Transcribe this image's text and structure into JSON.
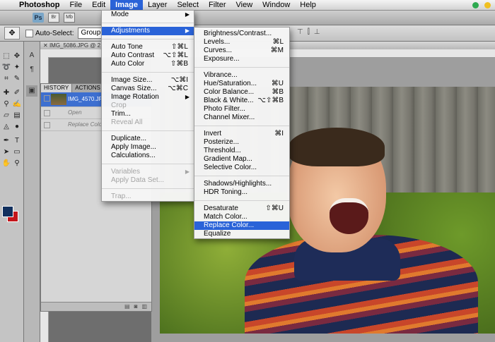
{
  "menubar": {
    "app_name": "Photoshop",
    "items": [
      "File",
      "Edit",
      "Image",
      "Layer",
      "Select",
      "Filter",
      "View",
      "Window",
      "Help"
    ],
    "active_item": "Image"
  },
  "appbar": {
    "logo": "Ps",
    "icons": [
      "Br",
      "Mb"
    ]
  },
  "options": {
    "auto_select_label": "Auto-Select:",
    "auto_select_value": "Group"
  },
  "document": {
    "tab_title": "IMG_5086.JPG @ 2"
  },
  "history_panel": {
    "tabs": [
      "HISTORY",
      "ACTIONS"
    ],
    "snapshot": "IMG_4570.JP",
    "steps": [
      "Open",
      "Replace Colo"
    ]
  },
  "image_menu": {
    "items": [
      {
        "label": "Mode",
        "shortcut": "",
        "submenu": true,
        "disabled": false
      },
      {
        "sep": true
      },
      {
        "label": "Adjustments",
        "shortcut": "",
        "submenu": true,
        "disabled": false,
        "highlighted": true
      },
      {
        "sep": true
      },
      {
        "label": "Auto Tone",
        "shortcut": "⇧⌘L"
      },
      {
        "label": "Auto Contrast",
        "shortcut": "⌥⇧⌘L"
      },
      {
        "label": "Auto Color",
        "shortcut": "⇧⌘B"
      },
      {
        "sep": true
      },
      {
        "label": "Image Size...",
        "shortcut": "⌥⌘I"
      },
      {
        "label": "Canvas Size...",
        "shortcut": "⌥⌘C"
      },
      {
        "label": "Image Rotation",
        "shortcut": "",
        "submenu": true
      },
      {
        "label": "Crop",
        "disabled": true
      },
      {
        "label": "Trim..."
      },
      {
        "label": "Reveal All",
        "disabled": true
      },
      {
        "sep": true
      },
      {
        "label": "Duplicate..."
      },
      {
        "label": "Apply Image..."
      },
      {
        "label": "Calculations..."
      },
      {
        "sep": true
      },
      {
        "label": "Variables",
        "submenu": true,
        "disabled": true
      },
      {
        "label": "Apply Data Set...",
        "disabled": true
      },
      {
        "sep": true
      },
      {
        "label": "Trap...",
        "disabled": true
      }
    ]
  },
  "adjustments_menu": {
    "items": [
      {
        "label": "Brightness/Contrast..."
      },
      {
        "label": "Levels...",
        "shortcut": "⌘L"
      },
      {
        "label": "Curves...",
        "shortcut": "⌘M"
      },
      {
        "label": "Exposure..."
      },
      {
        "sep": true
      },
      {
        "label": "Vibrance..."
      },
      {
        "label": "Hue/Saturation...",
        "shortcut": "⌘U"
      },
      {
        "label": "Color Balance...",
        "shortcut": "⌘B"
      },
      {
        "label": "Black & White...",
        "shortcut": "⌥⇧⌘B"
      },
      {
        "label": "Photo Filter..."
      },
      {
        "label": "Channel Mixer..."
      },
      {
        "sep": true
      },
      {
        "label": "Invert",
        "shortcut": "⌘I"
      },
      {
        "label": "Posterize..."
      },
      {
        "label": "Threshold..."
      },
      {
        "label": "Gradient Map..."
      },
      {
        "label": "Selective Color..."
      },
      {
        "sep": true
      },
      {
        "label": "Shadows/Highlights..."
      },
      {
        "label": "HDR Toning..."
      },
      {
        "sep": true
      },
      {
        "label": "Desaturate",
        "shortcut": "⇧⌘U"
      },
      {
        "label": "Match Color..."
      },
      {
        "label": "Replace Color...",
        "highlighted": true
      },
      {
        "label": "Equalize"
      }
    ]
  },
  "colors": {
    "accent": "#2a63d8",
    "foreground_swatch": "#12305e",
    "background_swatch": "#c4161c"
  }
}
